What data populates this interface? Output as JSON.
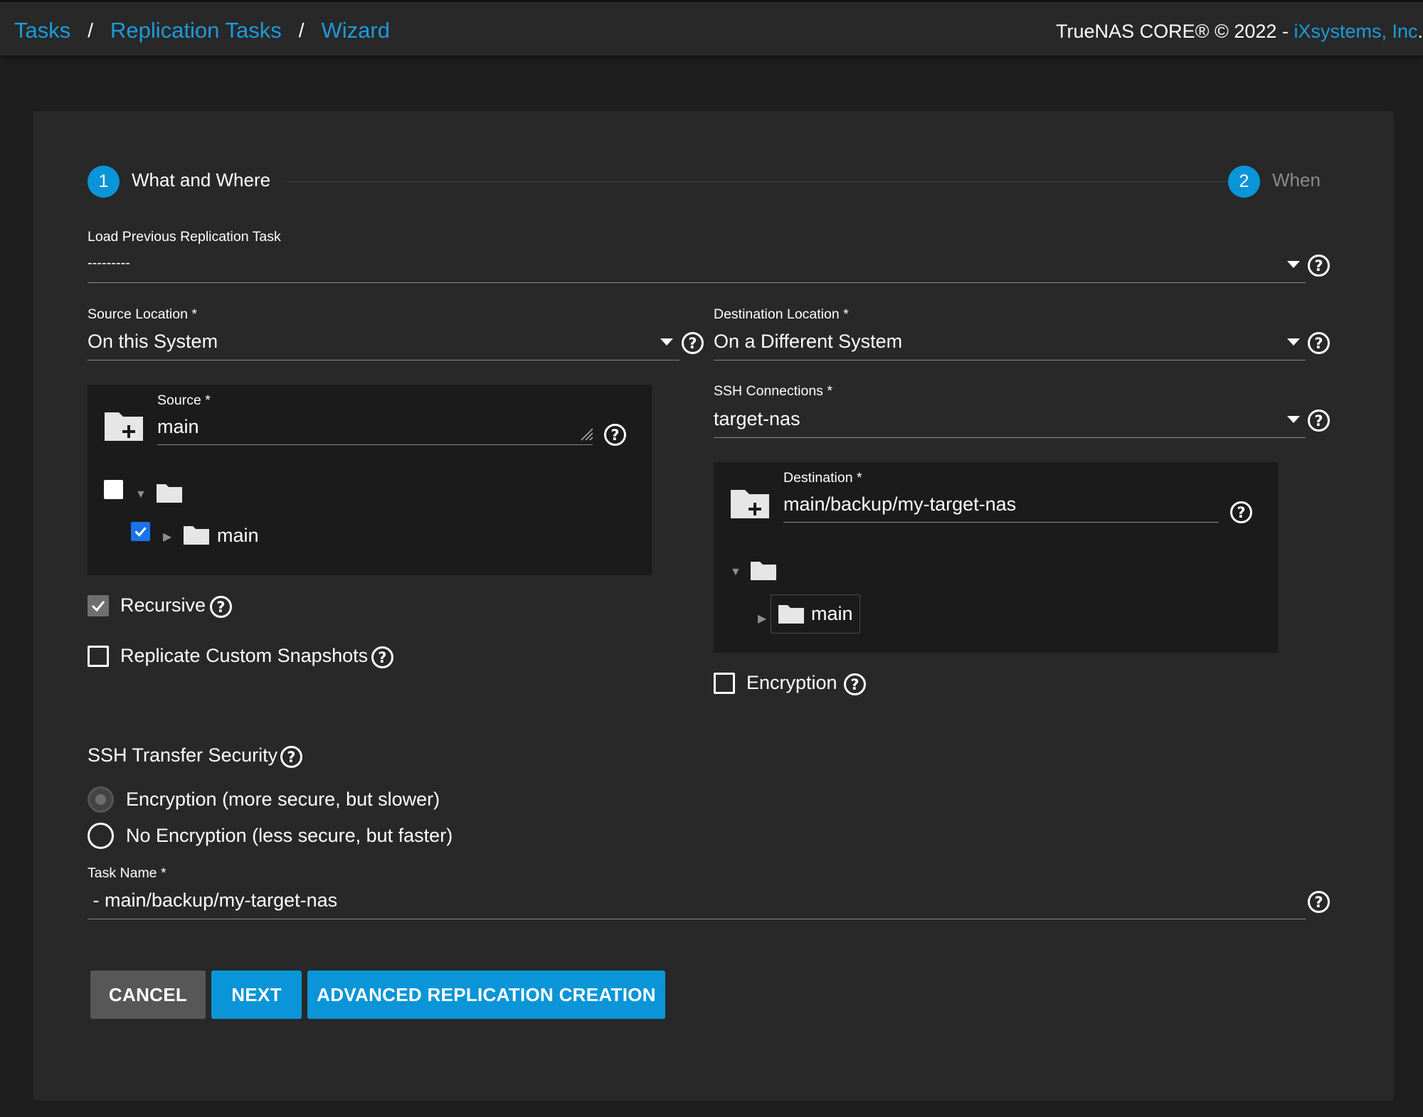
{
  "breadcrumb": {
    "items": [
      "Tasks",
      "Replication Tasks",
      "Wizard"
    ],
    "separator": "/"
  },
  "copyright": {
    "text": "TrueNAS CORE® © 2022 - ",
    "link": "iXsystems, Inc",
    "suffix": "."
  },
  "stepper": {
    "steps": [
      {
        "number": "1",
        "label": "What and Where"
      },
      {
        "number": "2",
        "label": "When"
      }
    ]
  },
  "form": {
    "load_previous": {
      "label": "Load Previous Replication Task",
      "value": "---------"
    },
    "source_location": {
      "label": "Source Location *",
      "value": "On this System"
    },
    "destination_location": {
      "label": "Destination Location *",
      "value": "On a Different System"
    },
    "source": {
      "label": "Source *",
      "value": "main",
      "tree_child": "main"
    },
    "ssh_connections": {
      "label": "SSH Connections *",
      "value": "target-nas"
    },
    "destination": {
      "label": "Destination *",
      "value": "main/backup/my-target-nas",
      "tree_child": "main"
    },
    "recursive": {
      "label": "Recursive",
      "checked": true
    },
    "replicate_custom_snapshots": {
      "label": "Replicate Custom Snapshots",
      "checked": false
    },
    "encryption": {
      "label": "Encryption",
      "checked": false
    },
    "ssh_transfer_security": {
      "label": "SSH Transfer Security",
      "options": [
        "Encryption (more secure, but slower)",
        "No Encryption (less secure, but faster)"
      ],
      "selected": "Encryption (more secure, but slower)"
    },
    "task_name": {
      "label": "Task Name *",
      "value": " - main/backup/my-target-nas"
    }
  },
  "buttons": {
    "cancel": "CANCEL",
    "next": "NEXT",
    "advanced": "ADVANCED REPLICATION CREATION"
  },
  "help_glyph": "?",
  "colors": {
    "accent": "#0a95d8",
    "background": "#1e1e1f",
    "card": "#282829",
    "panel": "#1b1b1c",
    "checkbox_checked": "#1a73e8"
  }
}
